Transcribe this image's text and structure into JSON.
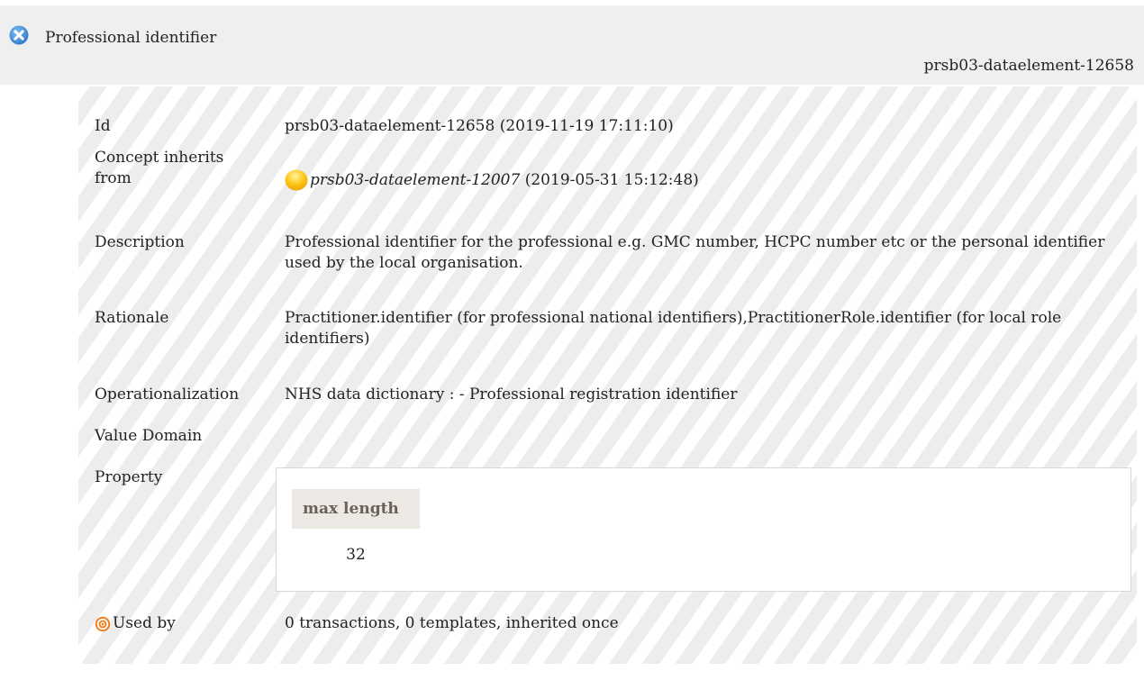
{
  "header": {
    "title": "Professional identifier",
    "element_id": "prsb03-dataelement-12658",
    "icon": "close-circle-icon",
    "icon_color": "#3a8fd6"
  },
  "detail": {
    "id": {
      "label": "Id",
      "value": "prsb03-dataelement-12658 (2019-11-19 17:11:10)"
    },
    "inherits": {
      "label_line1": "Concept inherits",
      "label_line2": "from",
      "icon": "yellow-circle-icon",
      "link": "prsb03-dataelement-12007",
      "date": "(2019-05-31 15:12:48)"
    },
    "description": {
      "label": "Description",
      "value": "Professional identifier for the professional e.g. GMC number, HCPC number etc or the personal identifier used by the local organisation."
    },
    "rationale": {
      "label": "Rationale",
      "value": "Practitioner.identifier (for professional national identifiers),PractitionerRole.identifier (for local role identifiers)"
    },
    "operationalization": {
      "label": "Operationalization",
      "value": "NHS data dictionary : - Professional registration identifier"
    },
    "value_domain": {
      "label": "Value Domain"
    },
    "property": {
      "label": "Property",
      "header": "max length",
      "value": "32"
    },
    "used_by": {
      "label": "Used by",
      "icon": "target-icon",
      "value": "0 transactions, 0 templates, inherited once"
    }
  },
  "colors": {
    "header_bg": "#efefef",
    "stripe_light": "#ffffff",
    "stripe_dark": "#ededed",
    "property_header_bg": "#ece9e5",
    "usedby_icon": "#f07f1b"
  }
}
